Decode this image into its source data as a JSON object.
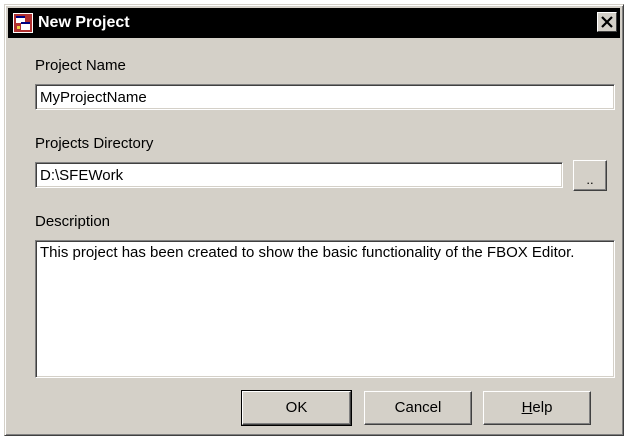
{
  "window": {
    "title": "New Project"
  },
  "project_name": {
    "label": "Project Name",
    "value": "MyProjectName"
  },
  "projects_directory": {
    "label": "Projects Directory",
    "value": "D:\\SFEWork",
    "browse_label": ".."
  },
  "description": {
    "label": "Description",
    "value": "This project has been created to show the basic functionality of the FBOX Editor."
  },
  "buttons": {
    "ok": "OK",
    "cancel": "Cancel",
    "help": "Help"
  },
  "icons": {
    "app": "app-window-icon",
    "close": "close-icon"
  },
  "colors": {
    "dialog_bg": "#d4d0c8",
    "titlebar_bg": "#000000",
    "titlebar_text": "#ffffff"
  }
}
